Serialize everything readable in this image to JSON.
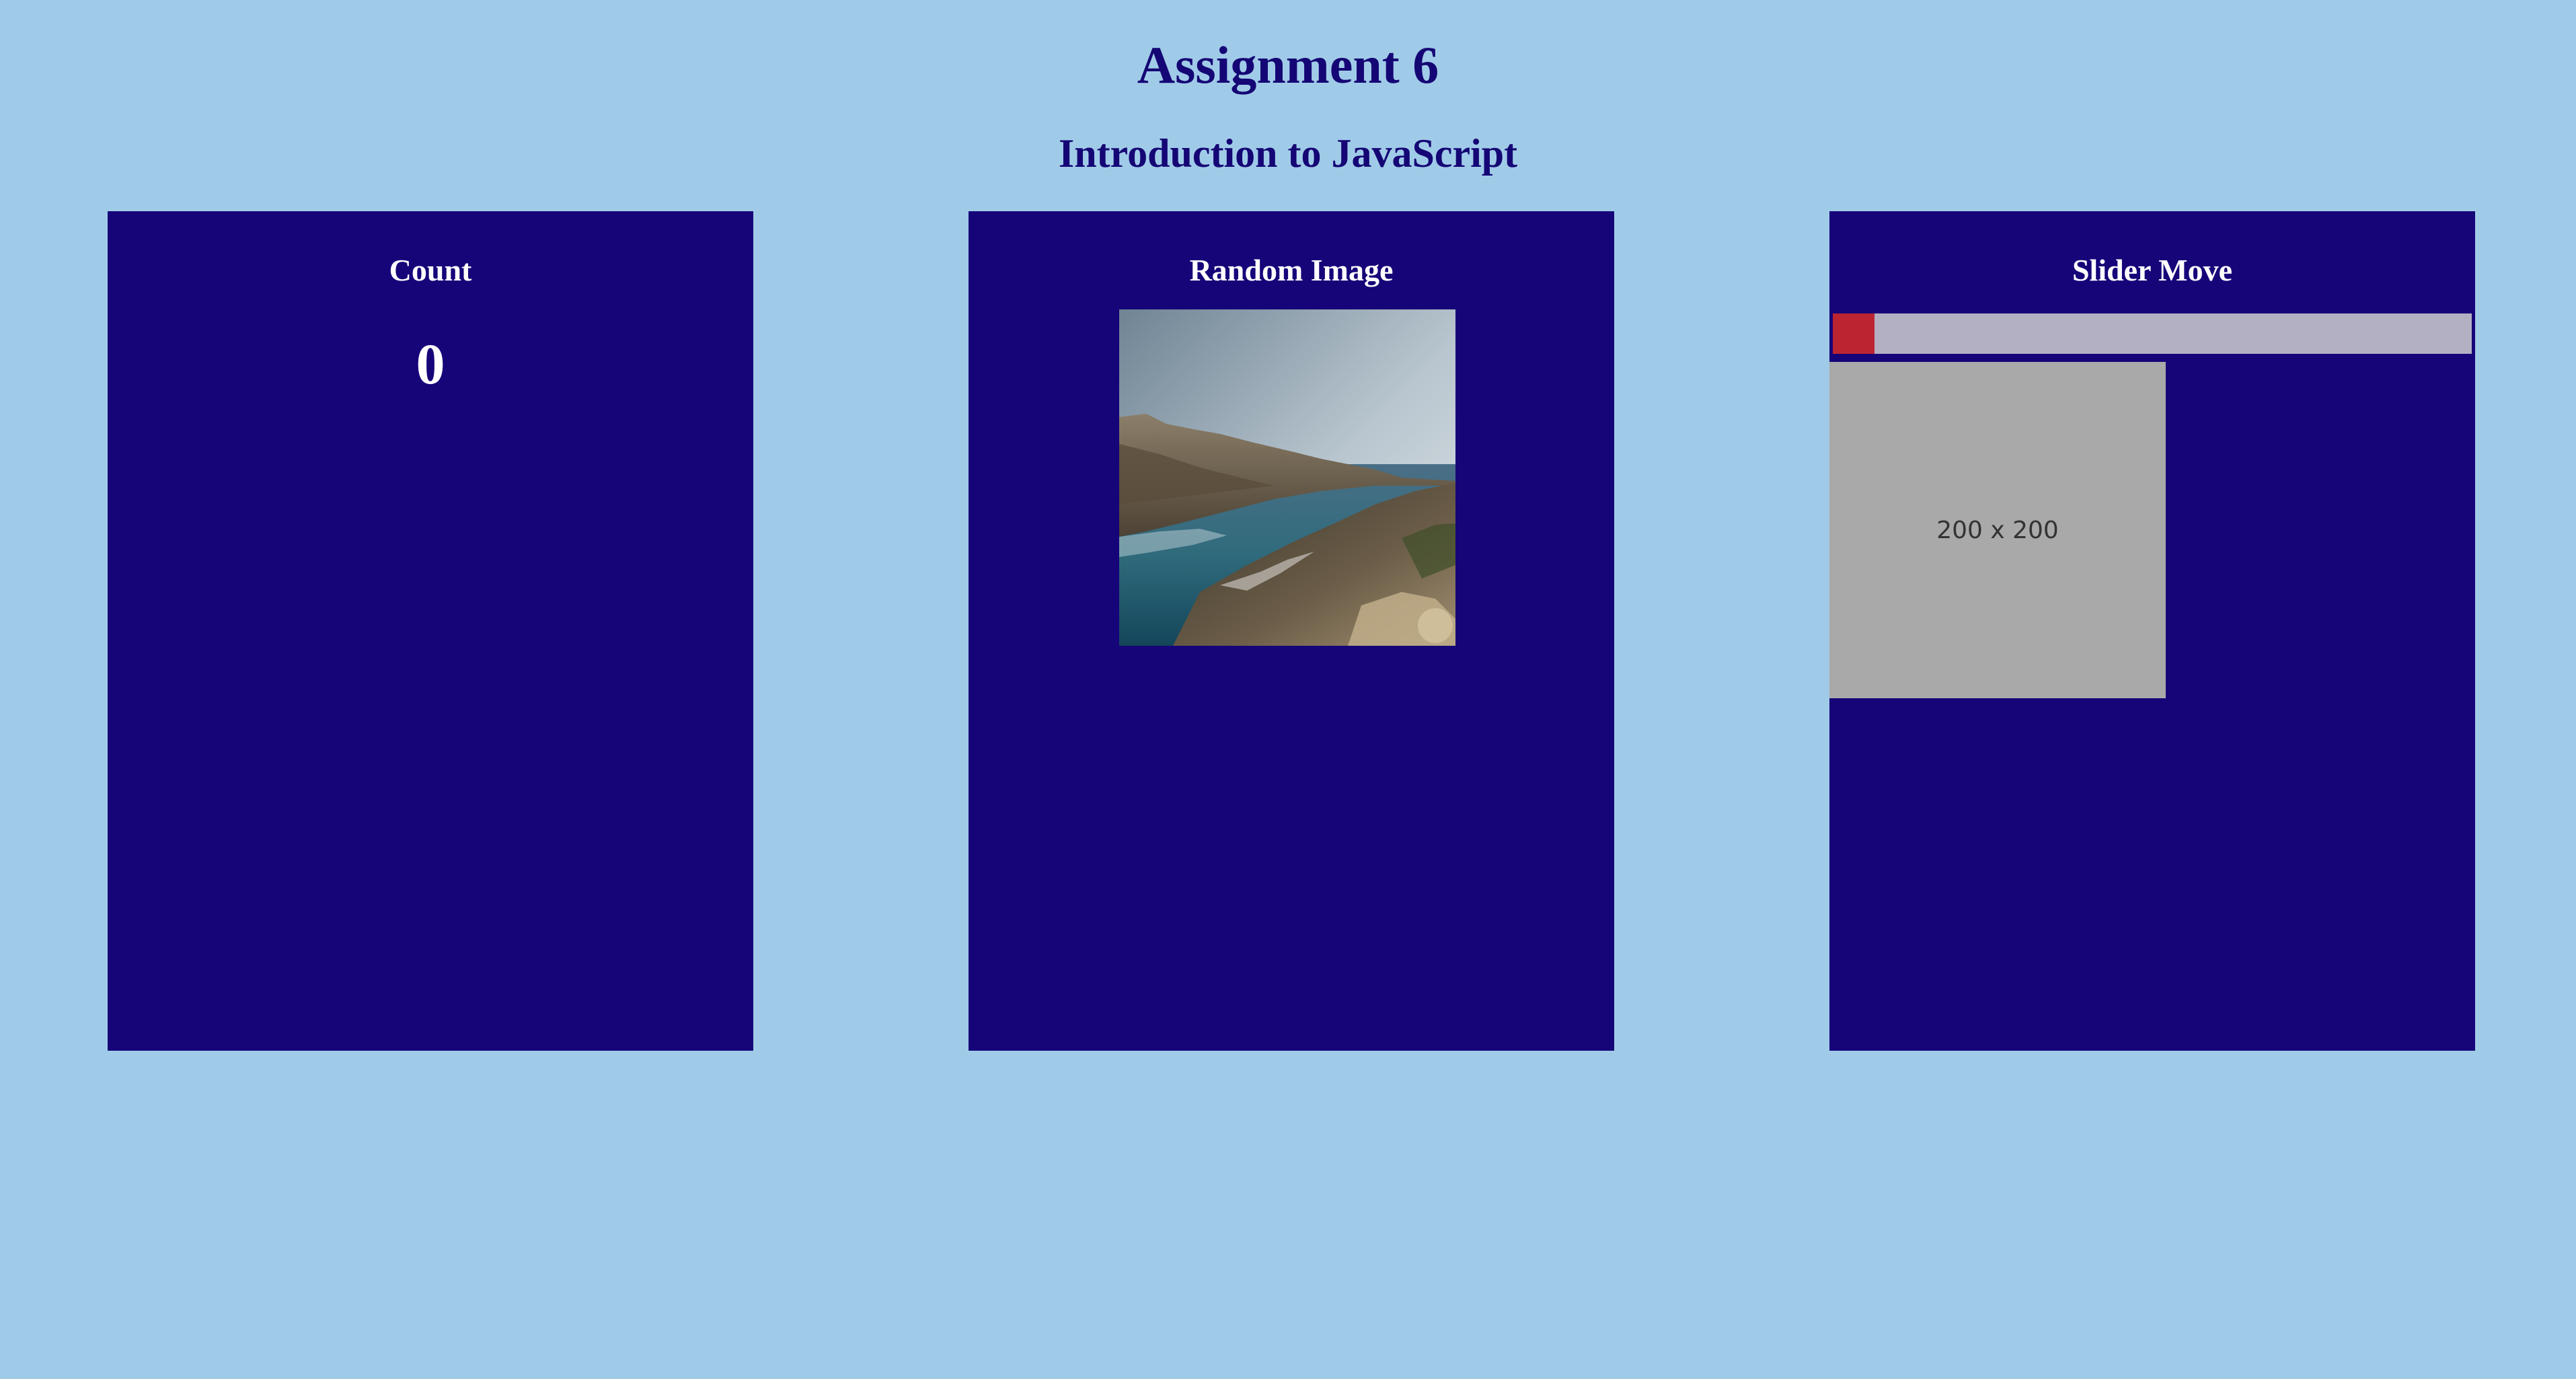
{
  "header": {
    "title": "Assignment 6",
    "subtitle": "Introduction to JavaScript"
  },
  "panels": {
    "count": {
      "title": "Count",
      "value": "0"
    },
    "random_image": {
      "title": "Random Image",
      "image_description": "rocky coastline with sea"
    },
    "slider": {
      "title": "Slider Move",
      "position_fraction": 0,
      "placeholder_text": "200 x 200"
    }
  },
  "colors": {
    "page_background": "#a0cbe8",
    "heading_text": "#150675",
    "panel_background": "#160479",
    "panel_text": "#ffffff",
    "slider_track": "#b4b0c4",
    "slider_handle": "#bc2432",
    "placeholder_background": "#a9a9a9"
  }
}
